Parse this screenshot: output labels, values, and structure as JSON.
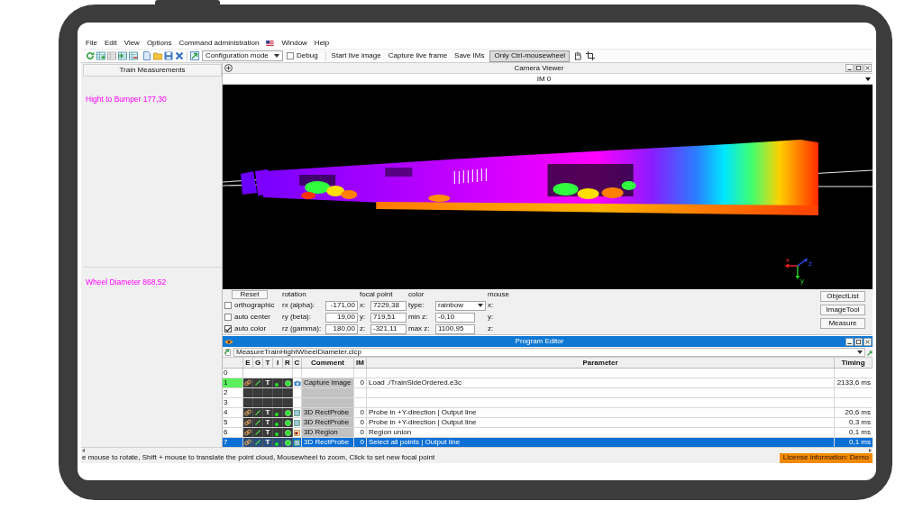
{
  "menu": [
    {
      "kind": "text",
      "label": "File"
    },
    {
      "kind": "text",
      "label": "Edit"
    },
    {
      "kind": "text",
      "label": "View"
    },
    {
      "kind": "text",
      "label": "Options"
    },
    {
      "kind": "text",
      "label": "Command administration"
    },
    {
      "kind": "flag"
    },
    {
      "kind": "text",
      "label": "Window"
    },
    {
      "kind": "text",
      "label": "Help"
    }
  ],
  "toolbar": {
    "mode_dropdown": "Configuration mode",
    "debug": {
      "label": "Debug",
      "checked": false
    },
    "actions": [
      "Start live image",
      "Capture live frame",
      "Save IMs"
    ],
    "mousewheel_toggle": {
      "label": "Only Ctrl-mousewheel",
      "on": true
    }
  },
  "measurements_panel": {
    "title": "Train Measurements",
    "items": [
      "Hight to Bumper 177,30",
      "Wheel Diameter 868,52"
    ]
  },
  "camera_viewer": {
    "title": "Camera Viewer",
    "image": "IM 0",
    "axis_labels": [
      "x",
      "y",
      "z"
    ],
    "reset": "Reset",
    "headings": [
      "rotation",
      "focal point",
      "color",
      "mouse"
    ],
    "rows": [
      {
        "option": "orthographic",
        "checked": false,
        "rotation_label": "rx (alpha):",
        "rotation": "-171,00",
        "focal_label": "x:",
        "focal": "7229,38",
        "color_label": "type:",
        "color_field": {
          "kind": "select",
          "value": "rainbow"
        },
        "mouse_label": "x:"
      },
      {
        "option": "auto center",
        "checked": false,
        "rotation_label": "ry (beta):",
        "rotation": "19,00",
        "focal_label": "y:",
        "focal": "719,51",
        "color_label": "min z:",
        "color_field": {
          "kind": "input",
          "value": "-0,10"
        },
        "mouse_label": "y:"
      },
      {
        "option": "auto color",
        "checked": true,
        "rotation_label": "rz (gamma):",
        "rotation": "180,00",
        "focal_label": "z:",
        "focal": "-321,11",
        "color_label": "max z:",
        "color_field": {
          "kind": "input",
          "value": "1100,95"
        },
        "mouse_label": "z:"
      }
    ],
    "buttons": [
      "ObjectList",
      "ImageTool",
      "Measure"
    ]
  },
  "program_editor": {
    "title": "Program Editor",
    "file": "MeasureTrainHightWheelDiameter.clcp",
    "columns": [
      "E",
      "G",
      "T",
      "I",
      "R",
      "C",
      "Comment",
      "IM",
      "Parameter",
      "Timing"
    ],
    "rows": [
      {
        "number": "0",
        "kind": "start",
        "current": false,
        "selected": false
      },
      {
        "number": "1",
        "kind": "capture",
        "current": true,
        "selected": false,
        "t_flag": "T",
        "comment": "Capture image",
        "im": "0",
        "parameter": "Load ./TrainSideOrdered.e3c",
        "timing": "2133,6 ms"
      },
      {
        "number": "2",
        "kind": "gap",
        "current": false,
        "selected": false
      },
      {
        "number": "3",
        "kind": "gap",
        "current": false,
        "selected": false
      },
      {
        "number": "4",
        "kind": "probe",
        "current": false,
        "selected": false,
        "t_flag": "T",
        "comment": "3D RectProbe",
        "im": "0",
        "parameter": "Probe in +Y-direction | Output line",
        "timing": "20,6 ms"
      },
      {
        "number": "5",
        "kind": "probe",
        "current": false,
        "selected": false,
        "t_flag": "T",
        "comment": "3D RectProbe",
        "im": "0",
        "parameter": "Probe in +Y-direction | Output line",
        "timing": "0,3 ms"
      },
      {
        "number": "6",
        "kind": "region",
        "current": false,
        "selected": false,
        "t_flag": "T",
        "comment": "3D Region",
        "im": "0",
        "parameter": "Region union",
        "timing": "0,1 ms"
      },
      {
        "number": "7",
        "kind": "probe",
        "current": false,
        "selected": true,
        "t_flag": "T",
        "comment": "3D RectProbe",
        "im": "0",
        "parameter": "Select all points | Output line",
        "timing": "0,1 ms"
      }
    ]
  },
  "status_bar": {
    "hint": "e mouse to rotate, Shift + mouse to translate the point cloud, Mousewheel to zoom, Click to set new focal point",
    "license": "License information: Demo"
  }
}
